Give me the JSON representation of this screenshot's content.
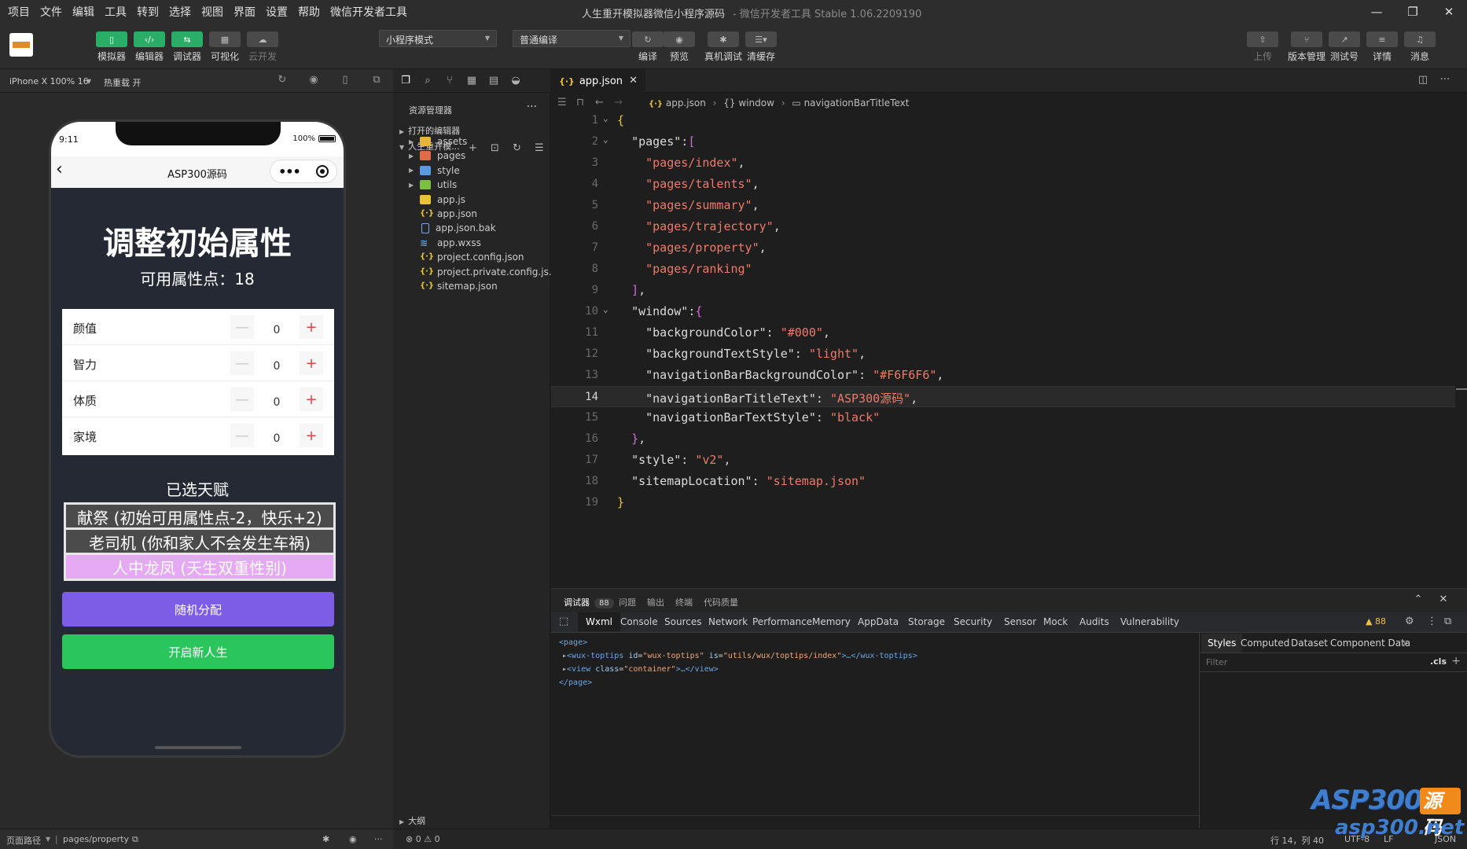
{
  "menu": [
    "项目",
    "文件",
    "编辑",
    "工具",
    "转到",
    "选择",
    "视图",
    "界面",
    "设置",
    "帮助",
    "微信开发者工具"
  ],
  "window": {
    "title": "人生重开模拟器微信小程序源码",
    "subtitle": "- 微信开发者工具 Stable 1.06.2209190",
    "minimize": "—",
    "restore": "❐",
    "close": "✕"
  },
  "toolbar": {
    "simulator": "模拟器",
    "editor": "编辑器",
    "debugger": "调试器",
    "visual": "可视化",
    "cloud": "云开发",
    "mode": "小程序模式",
    "compile_mode": "普通编译",
    "compile": "编译",
    "preview": "预览",
    "real_debug": "真机调试",
    "clear_cache": "清缓存",
    "upload": "上传",
    "version": "版本管理",
    "test_account": "测试号",
    "details": "详情",
    "messages": "消息"
  },
  "simbar": {
    "device": "iPhone X 100% 16",
    "hot_reload": "热重载 开"
  },
  "phone": {
    "time": "9:11",
    "battery": "100%",
    "nav_title": "ASP300源码",
    "heading": "调整初始属性",
    "points": "可用属性点：18",
    "attributes": [
      {
        "name": "颜值",
        "value": "0"
      },
      {
        "name": "智力",
        "value": "0"
      },
      {
        "name": "体质",
        "value": "0"
      },
      {
        "name": "家境",
        "value": "0"
      }
    ],
    "talent_title": "已选天赋",
    "talents": [
      "献祭 (初始可用属性点-2，快乐+2)",
      "老司机 (你和家人不会发生车祸)",
      "人中龙凤 (天生双重性别)"
    ],
    "random_button": "随机分配",
    "start_button": "开启新人生"
  },
  "explorer": {
    "title": "资源管理器",
    "open_editors": "打开的编辑器",
    "project": "人生重开模...",
    "outline": "大纲",
    "items": [
      {
        "name": "assets",
        "type": "folder-yellow"
      },
      {
        "name": "pages",
        "type": "folder-red"
      },
      {
        "name": "style",
        "type": "folder-blue"
      },
      {
        "name": "utils",
        "type": "folder-green"
      },
      {
        "name": "app.js",
        "type": "js"
      },
      {
        "name": "app.json",
        "type": "json"
      },
      {
        "name": "app.json.bak",
        "type": "bak"
      },
      {
        "name": "app.wxss",
        "type": "wxss"
      },
      {
        "name": "project.config.json",
        "type": "json"
      },
      {
        "name": "project.private.config.js...",
        "type": "json"
      },
      {
        "name": "sitemap.json",
        "type": "json"
      }
    ]
  },
  "editor": {
    "tab": "app.json",
    "breadcrumb": [
      "app.json",
      "window",
      "navigationBarTitleText"
    ],
    "active_line": 14,
    "lines": [
      "{",
      "  \"pages\":[",
      "    \"pages/index\",",
      "    \"pages/talents\",",
      "    \"pages/summary\",",
      "    \"pages/trajectory\",",
      "    \"pages/property\",",
      "    \"pages/ranking\"",
      "  ],",
      "  \"window\":{",
      "    \"backgroundColor\": \"#000\",",
      "    \"backgroundTextStyle\": \"light\",",
      "    \"navigationBarBackgroundColor\": \"#F6F6F6\",",
      "    \"navigationBarTitleText\": \"ASP300源码\",",
      "    \"navigationBarTextStyle\": \"black\"",
      "  },",
      "  \"style\": \"v2\",",
      "  \"sitemapLocation\": \"sitemap.json\"",
      "}"
    ]
  },
  "debugger": {
    "tabs": [
      "调试器",
      "问题",
      "输出",
      "终端",
      "代码质量"
    ],
    "badge": "88",
    "devtools_tabs": [
      "Wxml",
      "Console",
      "Sources",
      "Network",
      "Performance",
      "Memory",
      "AppData",
      "Storage",
      "Security",
      "Sensor",
      "Mock",
      "Audits",
      "Vulnerability"
    ],
    "warnings": "▲ 88",
    "style_tabs": [
      "Styles",
      "Computed",
      "Dataset",
      "Component Data"
    ],
    "filter_placeholder": "Filter",
    "cls": ".cls",
    "dom": {
      "page_open": "<page>",
      "n1_tag": "wux-toptips",
      "n1_id": "wux-toptips",
      "n1_is": "utils/wux/toptips/index",
      "n2_tag": "view",
      "n2_class": "container",
      "page_close": "</page>"
    }
  },
  "statusbar": {
    "page_path_label": "页面路径",
    "page_path": "pages/property",
    "problems": "⊗ 0 ⚠ 0",
    "cursor": "行 14，列 40",
    "encoding": "UTF-8",
    "eol": "LF",
    "lang": "JSON"
  },
  "watermark": {
    "brand": "ASP300",
    "tag": "源码",
    "site": "asp300.net"
  }
}
